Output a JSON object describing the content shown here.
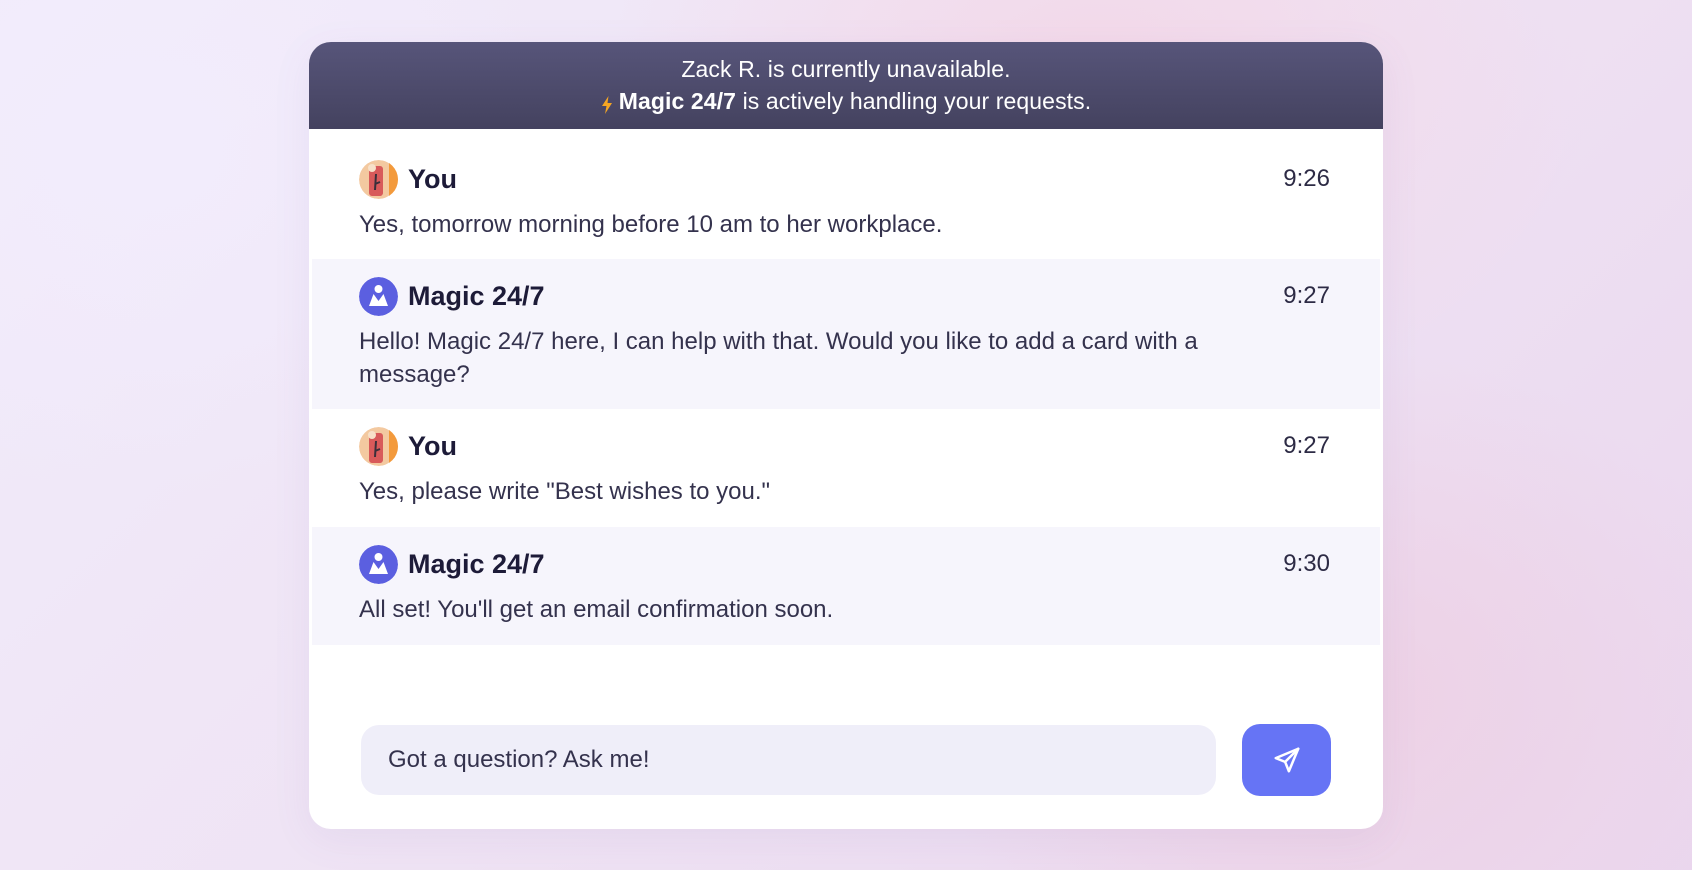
{
  "banner": {
    "line1": "Zack R. is currently unavailable.",
    "line2_bold": "Magic 24/7",
    "line2_rest": "is actively handling your requests.",
    "icon": "lightning-bolt-icon"
  },
  "messages": [
    {
      "sender": "You",
      "time": "9:26",
      "text": "Yes, tomorrow morning before 10 am to her workplace.",
      "avatar": "user-avatar"
    },
    {
      "sender": "Magic 24/7",
      "time": "9:27",
      "text": "Hello! Magic 24/7 here, I can help with that. Would you like to add a card with a message?",
      "avatar": "magic-avatar"
    },
    {
      "sender": "You",
      "time": "9:27",
      "text": "Yes, please write \"Best wishes to you.\"",
      "avatar": "user-avatar"
    },
    {
      "sender": "Magic 24/7",
      "time": "9:30",
      "text": "All set! You'll get an email confirmation soon.",
      "avatar": "magic-avatar"
    }
  ],
  "composer": {
    "placeholder": "Got a question? Ask me!",
    "send_icon": "paper-plane-icon"
  },
  "colors": {
    "banner": "#4c4a6b",
    "accent": "#6674f5",
    "bot_avatar": "#5b5fe0",
    "bot_row": "#f6f5fc",
    "input_bg": "#efeef9",
    "bolt": "#f5a623"
  }
}
